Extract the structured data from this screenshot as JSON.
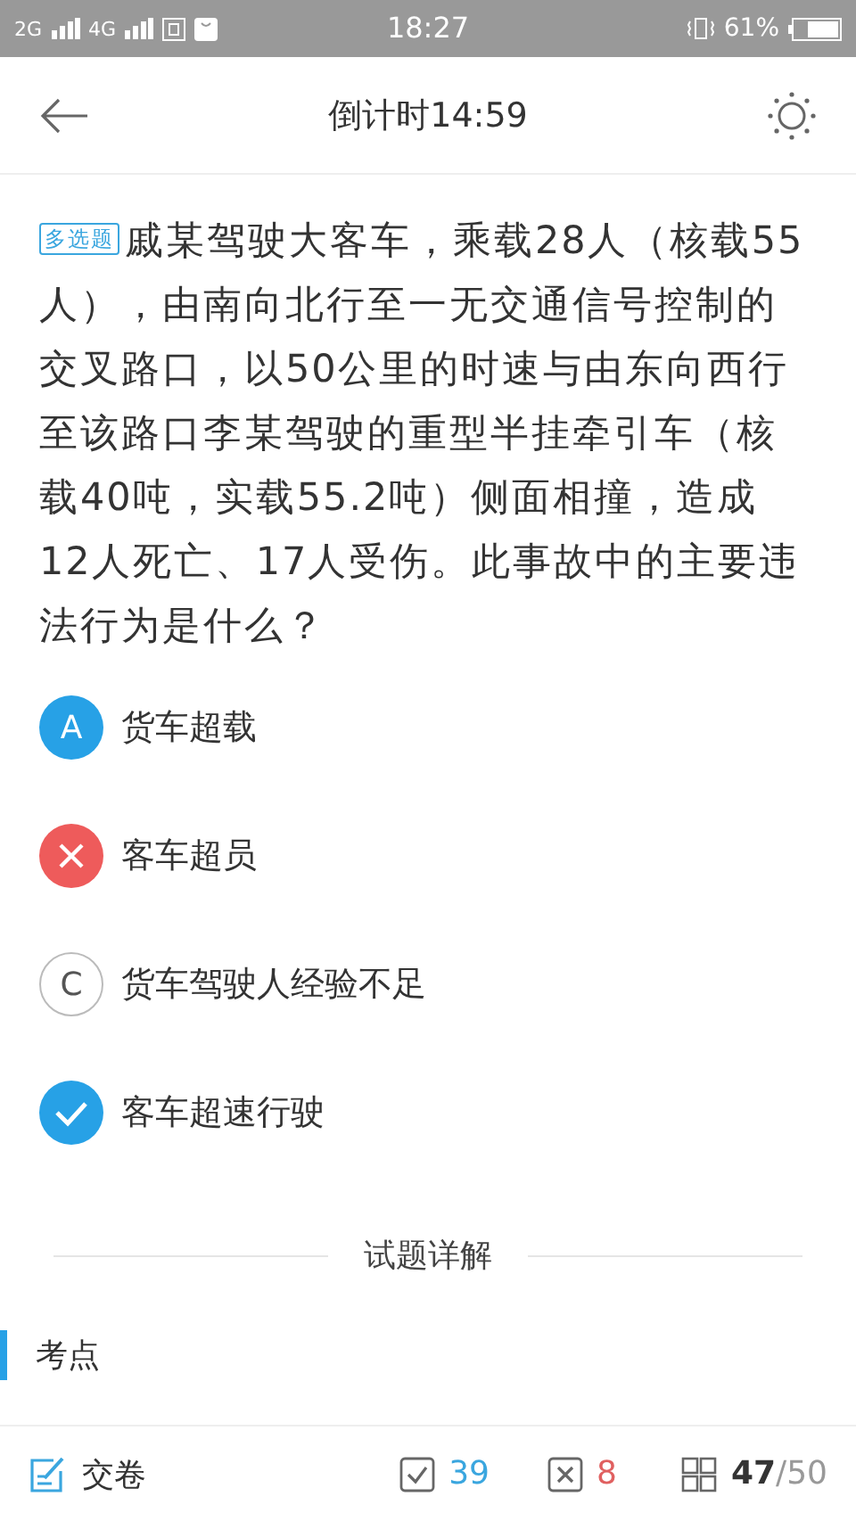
{
  "status_bar": {
    "network_1": "2G",
    "network_2": "4G",
    "time": "18:27",
    "battery": "61%"
  },
  "header": {
    "title": "倒计时14:59"
  },
  "question": {
    "type_badge": "多选题",
    "text": "戚某驾驶大客车，乘载28人（核载55人），由南向北行至一无交通信号控制的交叉路口，以50公里的时速与由东向西行至该路口李某驾驶的重型半挂牵引车（核载40吨，实载55.2吨）侧面相撞，造成12人死亡、17人受伤。此事故中的主要违法行为是什么？"
  },
  "options": [
    {
      "kind": "chosen",
      "letter": "A",
      "text": "货车超载"
    },
    {
      "kind": "wrong",
      "text": "客车超员"
    },
    {
      "kind": "plain",
      "letter": "C",
      "text": "货车驾驶人经验不足"
    },
    {
      "kind": "correct",
      "text": "客车超速行驶"
    }
  ],
  "explanation": {
    "divider_label": "试题详解",
    "section_title": "考点"
  },
  "bottom_bar": {
    "submit": "交卷",
    "correct_count": "39",
    "wrong_count": "8",
    "current": "47",
    "total": "/50"
  }
}
